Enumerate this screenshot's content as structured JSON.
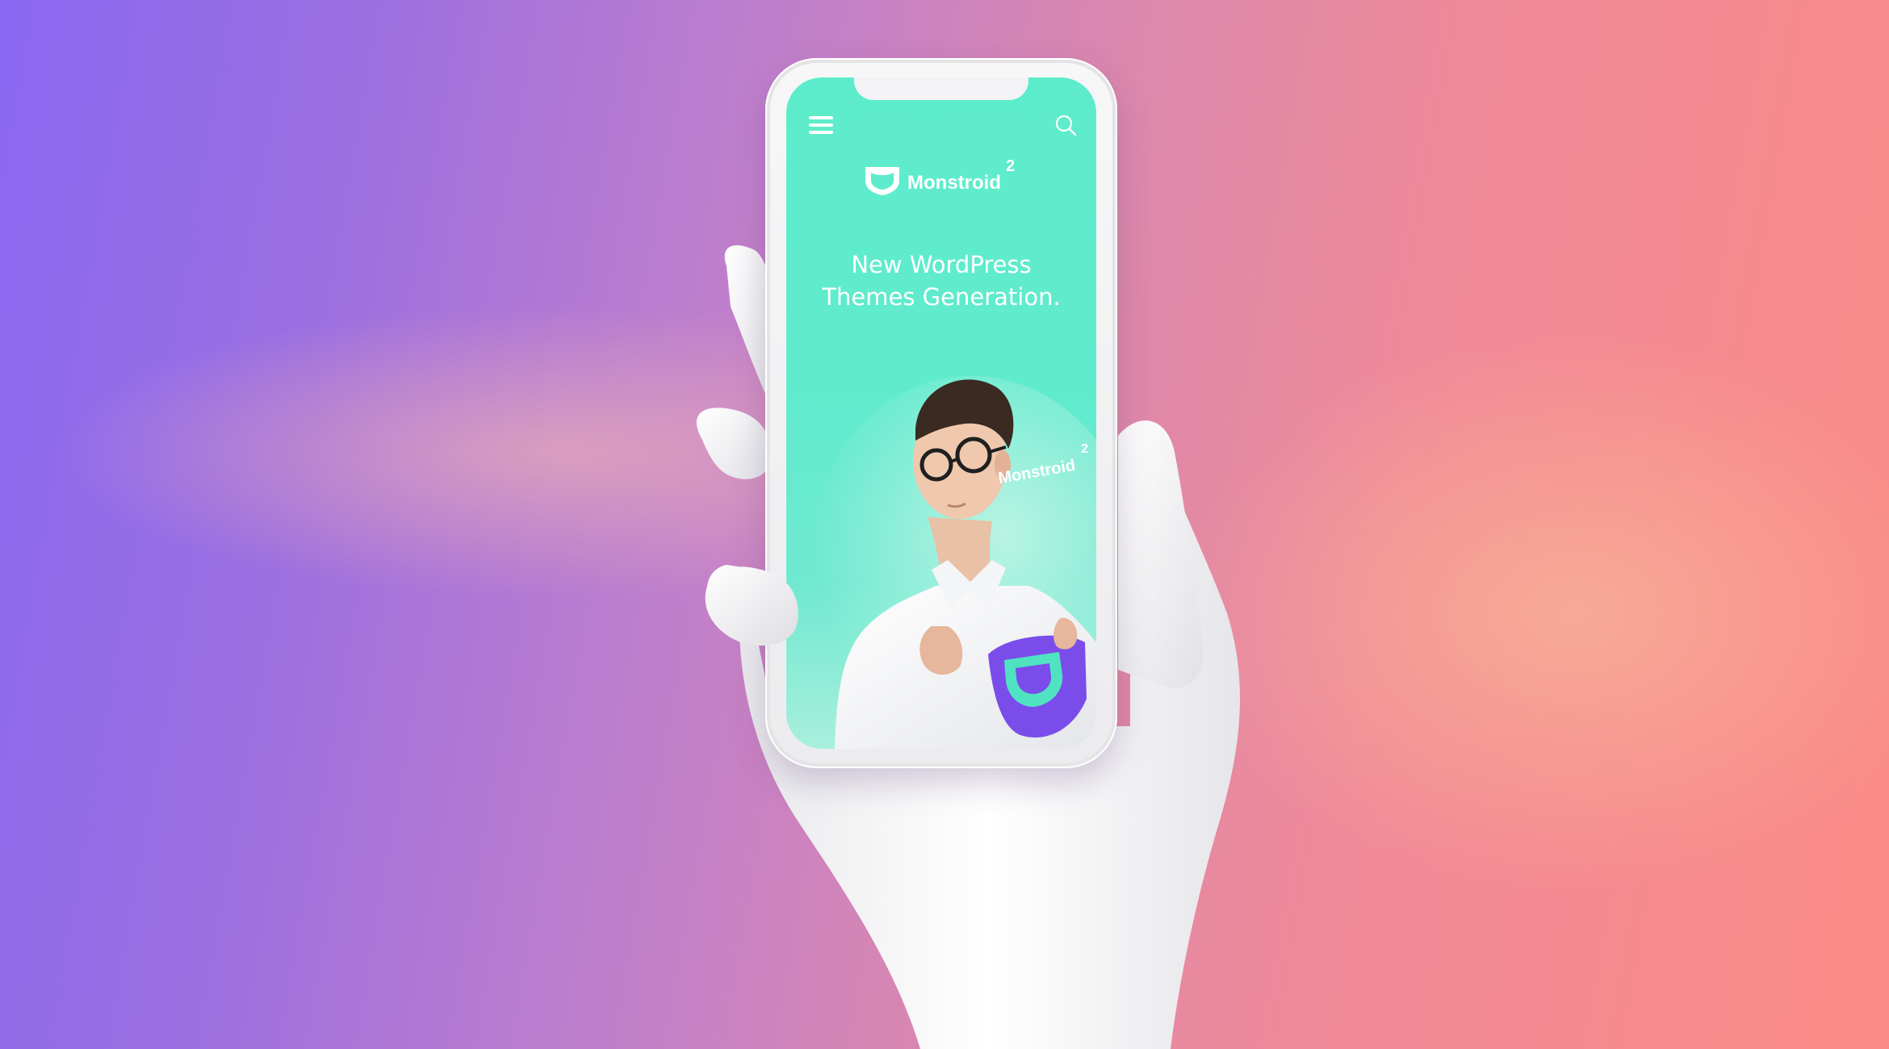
{
  "site": {
    "brand_name": "Monstroid",
    "brand_superscript": "2",
    "headline_line1": "New WordPress",
    "headline_line2": "Themes Generation."
  },
  "hero": {
    "shirt_brand": "Monstroid",
    "shirt_superscript": "2"
  },
  "icons": {
    "menu": "hamburger-menu-icon",
    "search": "search-icon",
    "logo": "shield-logo-icon"
  },
  "colors": {
    "screen_bg": "#5deccb",
    "shirt_purple": "#7a4dea",
    "logo_teal": "#4fe3c2",
    "background_left": "#8a68f2",
    "background_right": "#fb8a86"
  }
}
